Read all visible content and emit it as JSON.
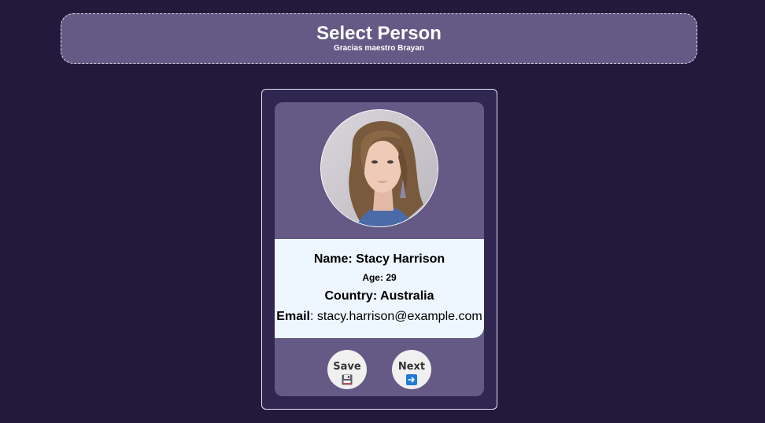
{
  "header": {
    "title": "Select Person",
    "subtitle": "Gracias maestro Brayan"
  },
  "person": {
    "name_label": "Name:",
    "name": "Stacy Harrison",
    "age_label": "Age:",
    "age": "29",
    "country_label": "Country:",
    "country": "Australia",
    "email_label": "Email",
    "email_sep": ":",
    "email": "stacy.harrison@example.com",
    "photo_icon": "portrait-photo"
  },
  "actions": {
    "save_label": "Save",
    "save_icon": "floppy-disk-icon",
    "next_label": "Next",
    "next_icon": "right-arrow-icon"
  },
  "colors": {
    "background": "#211a3a",
    "panel": "#645a85",
    "info_panel": "#eef6ff",
    "button": "#f0f0f0"
  }
}
